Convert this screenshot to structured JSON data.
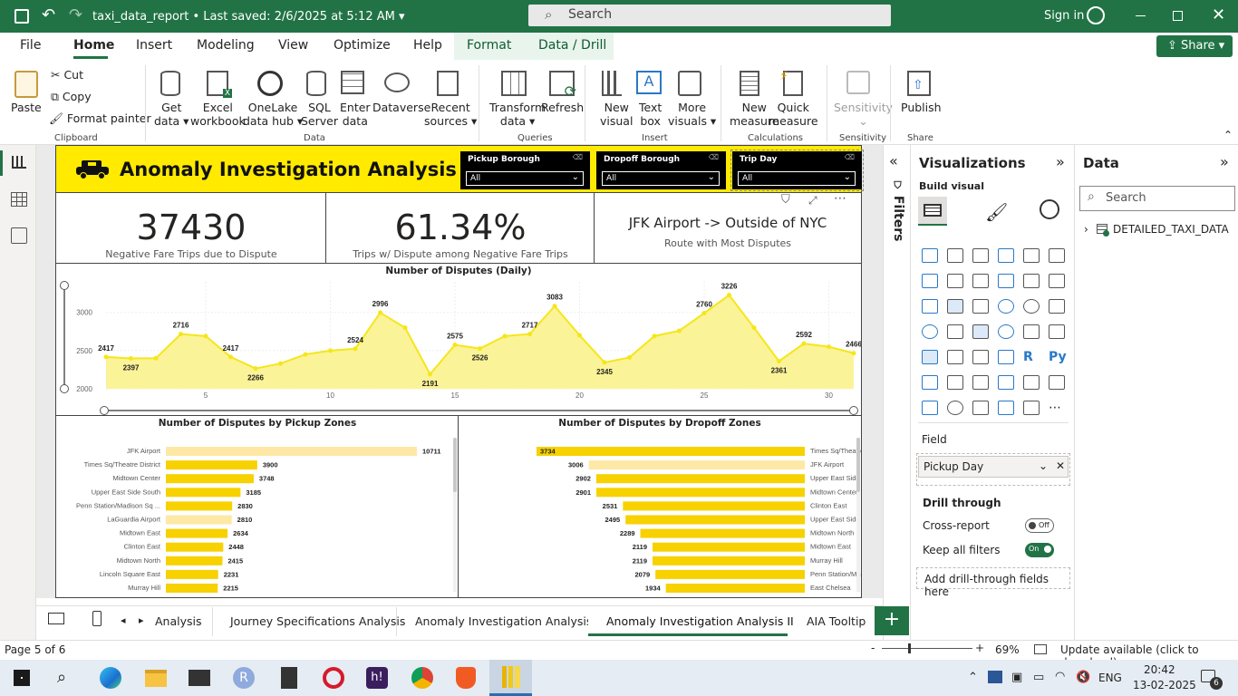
{
  "titlebar": {
    "title": "taxi_data_report • Last saved: 2/6/2025 at 5:12 AM",
    "search": "Search",
    "signin": "Sign in"
  },
  "menu": {
    "file": "File",
    "home": "Home",
    "insert": "Insert",
    "modeling": "Modeling",
    "view": "View",
    "optimize": "Optimize",
    "help": "Help",
    "format": "Format",
    "data_drill": "Data / Drill",
    "share": "Share"
  },
  "ribbon": {
    "paste": "Paste",
    "cut": "Cut",
    "copy": "Copy",
    "format_painter": "Format painter",
    "clipboard": "Clipboard",
    "get_data": [
      "Get",
      "data"
    ],
    "excel": [
      "Excel",
      "workbook"
    ],
    "onelake": [
      "OneLake",
      "data hub"
    ],
    "sql": [
      "SQL",
      "Server"
    ],
    "enter_data": [
      "Enter",
      "data"
    ],
    "dataverse": "Dataverse",
    "recent": [
      "Recent",
      "sources"
    ],
    "data_grp": "Data",
    "transform": [
      "Transform",
      "data"
    ],
    "refresh": "Refresh",
    "queries": "Queries",
    "new_visual": [
      "New",
      "visual"
    ],
    "text_box": [
      "Text",
      "box"
    ],
    "more_visuals": [
      "More",
      "visuals"
    ],
    "insert_grp": "Insert",
    "new_measure": [
      "New",
      "measure"
    ],
    "quick_measure": [
      "Quick",
      "measure"
    ],
    "calculations": "Calculations",
    "sensitivity": "Sensitivity",
    "sensitivity_grp": "Sensitivity",
    "publish": "Publish",
    "share_grp": "Share"
  },
  "report": {
    "title": "Anomaly Investigation Analysis II",
    "slicers": [
      {
        "header": "Pickup Borough",
        "value": "All"
      },
      {
        "header": "Dropoff Borough",
        "value": "All"
      },
      {
        "header": "Trip Day",
        "value": "All"
      }
    ],
    "kpis": [
      {
        "value": "37430",
        "label": "Negative Fare Trips due to Dispute"
      },
      {
        "value": "61.34%",
        "label": "Trips w/ Dispute among Negative Fare Trips"
      },
      {
        "value": "JFK Airport -> Outside of NYC",
        "label": "Route with Most Disputes"
      }
    ]
  },
  "chart_data": [
    {
      "type": "area",
      "title": "Number of Disputes (Daily)",
      "x": [
        1,
        2,
        3,
        4,
        5,
        6,
        7,
        8,
        9,
        10,
        11,
        12,
        13,
        14,
        15,
        16,
        17,
        18,
        19,
        20,
        21,
        22,
        23,
        24,
        25,
        26,
        27,
        28,
        29,
        30,
        31
      ],
      "values": [
        2417,
        2397,
        2400,
        2716,
        2690,
        2417,
        2266,
        2330,
        2450,
        2500,
        2524,
        2996,
        2800,
        2191,
        2575,
        2526,
        2690,
        2717,
        3083,
        2700,
        2345,
        2410,
        2690,
        2760,
        2990,
        3226,
        2800,
        2361,
        2592,
        2550,
        2466
      ],
      "labels": {
        "1": "2417",
        "2": "2397",
        "4": "2716",
        "6": "2417",
        "7": "2266",
        "11": "2524",
        "12": "2996",
        "14": "2191",
        "15": "2575",
        "16": "2526",
        "18": "2717",
        "19": "3083",
        "21": "2345",
        "25": "2760",
        "26": "3226",
        "28": "2361",
        "29": "2592",
        "31": "2466"
      },
      "x_ticks": [
        5,
        10,
        15,
        20,
        25,
        30
      ],
      "y_ticks": [
        2000,
        2500,
        3000
      ],
      "ylim": [
        2000,
        3400
      ],
      "color": "#f5e61a"
    },
    {
      "type": "bar",
      "title": "Number of Disputes by Pickup Zones",
      "categories": [
        "JFK Airport",
        "Times Sq/Theatre District",
        "Midtown Center",
        "Upper East Side South",
        "Penn Station/Madison Sq ...",
        "LaGuardia Airport",
        "Midtown East",
        "Clinton East",
        "Midtown North",
        "Lincoln Square East",
        "Murray Hill"
      ],
      "values": [
        10711,
        3900,
        3748,
        3185,
        2830,
        2810,
        2634,
        2448,
        2415,
        2231,
        2215
      ],
      "highlight": [
        0,
        5
      ]
    },
    {
      "type": "bar",
      "title": "Number of Disputes by Dropoff Zones",
      "categories": [
        "Times Sq/Theatre District",
        "JFK Airport",
        "Upper East Side South",
        "Midtown Center",
        "Clinton East",
        "Upper East Side North",
        "Midtown North",
        "Midtown East",
        "Murray Hill",
        "Penn Station/Madison Sq ...",
        "East Chelsea"
      ],
      "values": [
        3734,
        3006,
        2902,
        2901,
        2531,
        2495,
        2289,
        2119,
        2119,
        2079,
        1934
      ],
      "highlight": [
        1
      ]
    }
  ],
  "panes": {
    "filters": "Filters",
    "viz_title": "Visualizations",
    "build_visual": "Build visual",
    "field": "Field",
    "field_value": "Pickup Day",
    "drill_through": "Drill through",
    "cross_report": "Cross-report",
    "cross_report_state": "Off",
    "keep_filters": "Keep all filters",
    "keep_filters_state": "On",
    "add_drill": "Add drill-through fields here",
    "data_title": "Data",
    "data_search": "Search",
    "table": "DETAILED_TAXI_DATA"
  },
  "tabs": [
    "Analysis",
    "Journey Specifications Analysis",
    "Anomaly Investigation Analysis I",
    "Anomaly Investigation Analysis II",
    "AIA Tooltip"
  ],
  "status": {
    "page": "Page 5 of 6",
    "zoom": "69%",
    "update": "Update available (click to download)"
  },
  "taskbar": {
    "lang": "ENG",
    "time": "20:42",
    "date": "13-02-2025",
    "badge": "6"
  }
}
